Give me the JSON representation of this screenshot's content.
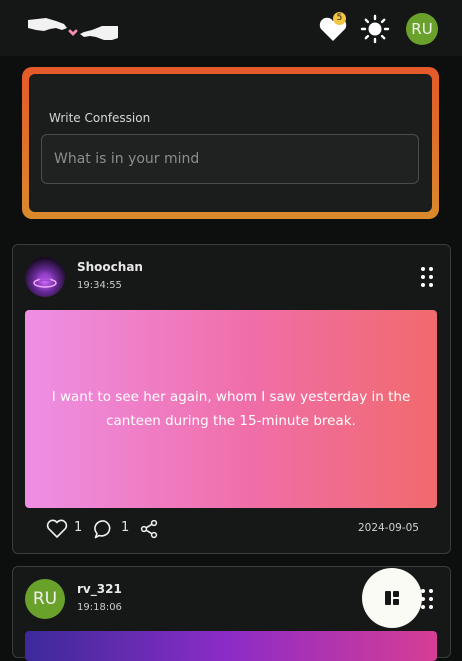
{
  "header": {
    "logo_icon": "creation-of-adam-hands-logo",
    "notifications": {
      "icon": "heart-icon",
      "count": "5"
    },
    "theme_icon": "sun-icon",
    "user_initials": "RU",
    "colors": {
      "avatar_bg": "#6aa12b",
      "badge_bg": "#f4c542"
    }
  },
  "composer": {
    "label": "Write Confession",
    "placeholder": "What is in your mind",
    "colors": {
      "border_gradient": [
        "#e4592a",
        "#d98a2b"
      ]
    }
  },
  "posts": [
    {
      "author": "Shoochan",
      "time": "19:34:55",
      "avatar_icon": "purple-glow-avatar",
      "text": "I want to see her again, whom I saw yesterday in the canteen during the 15-minute break.",
      "likes": "1",
      "comments": "1",
      "date": "2024-09-05",
      "colors": {
        "gradient": [
          "#ee8fe5",
          "#f06ea8",
          "#f16a6c"
        ]
      }
    },
    {
      "author": "rv_321",
      "time": "19:18:06",
      "avatar_initials": "RU",
      "colors": {
        "gradient": [
          "#3c2a9a",
          "#8d2cc7",
          "#d73d93"
        ]
      }
    }
  ],
  "fab": {
    "icon": "layout-grid-icon"
  }
}
